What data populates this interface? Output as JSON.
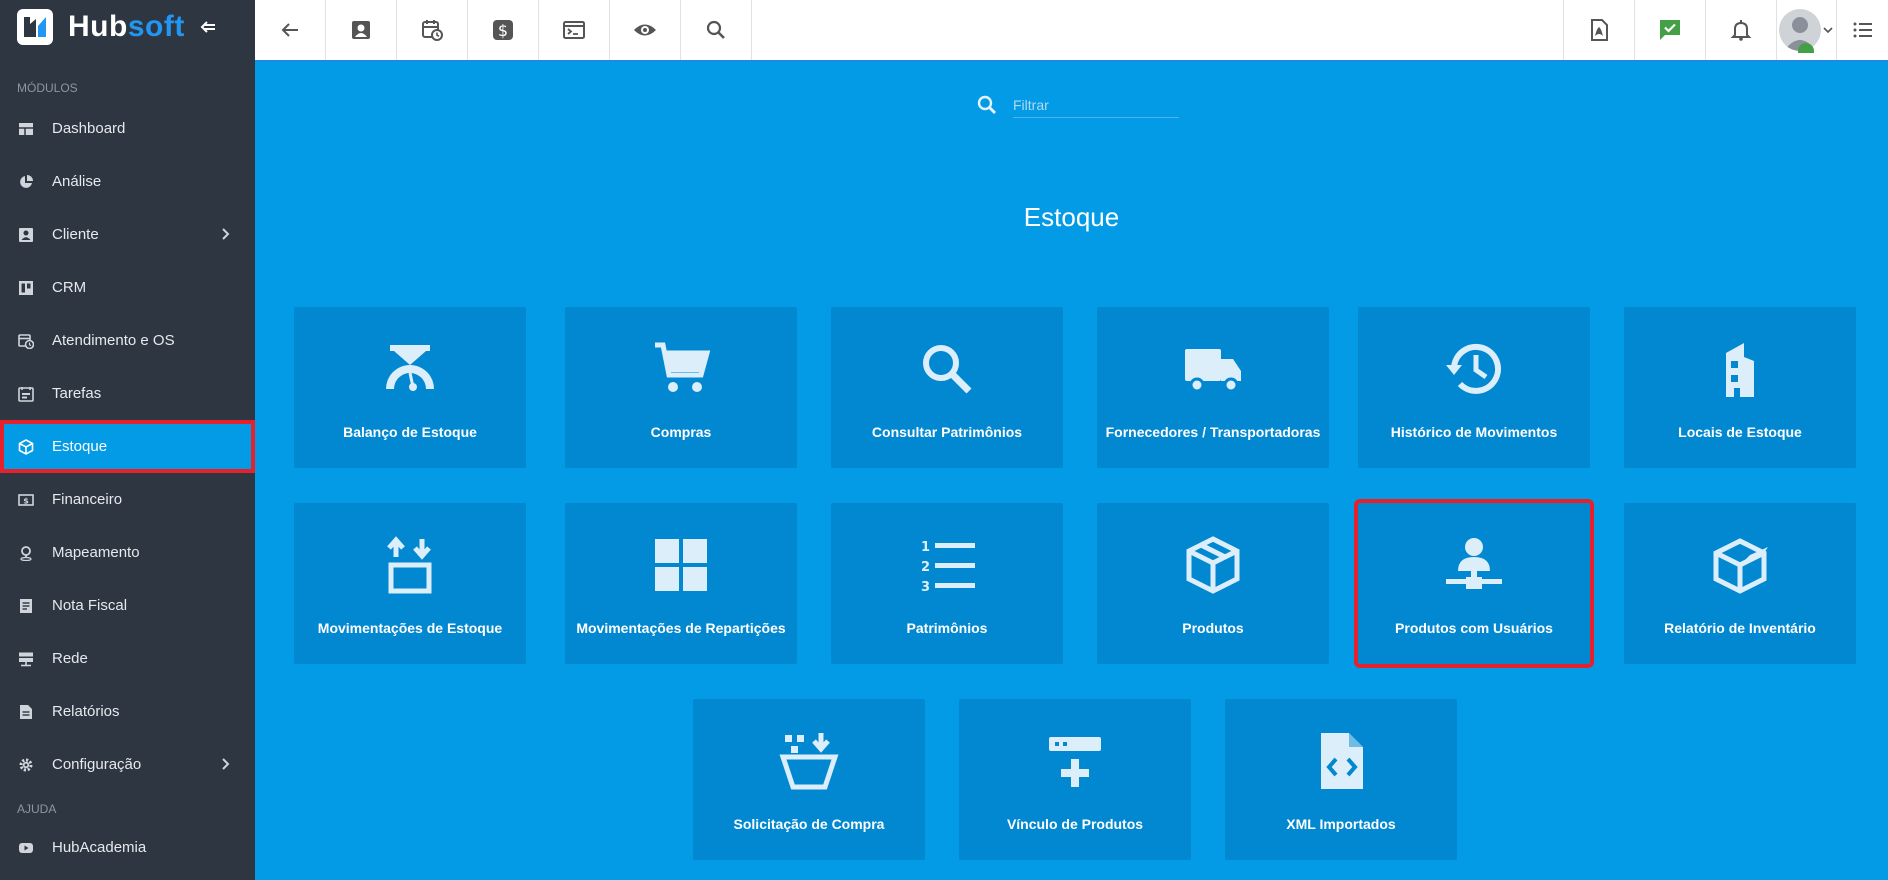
{
  "brand": {
    "hub": "Hub",
    "soft": "soft"
  },
  "sidebar": {
    "section_modulos": "MÓDULOS",
    "section_ajuda": "AJUDA",
    "items": [
      {
        "label": "Dashboard",
        "icon": "dashboard-icon"
      },
      {
        "label": "Análise",
        "icon": "pie-chart-icon"
      },
      {
        "label": "Cliente",
        "icon": "contact-card-icon",
        "has_submenu": true
      },
      {
        "label": "CRM",
        "icon": "kanban-icon"
      },
      {
        "label": "Atendimento e OS",
        "icon": "calendar-clock-icon"
      },
      {
        "label": "Tarefas",
        "icon": "tasks-icon"
      },
      {
        "label": "Estoque",
        "icon": "cube-icon",
        "active": true
      },
      {
        "label": "Financeiro",
        "icon": "money-icon"
      },
      {
        "label": "Mapeamento",
        "icon": "map-pin-icon"
      },
      {
        "label": "Nota Fiscal",
        "icon": "document-icon"
      },
      {
        "label": "Rede",
        "icon": "server-icon"
      },
      {
        "label": "Relatórios",
        "icon": "report-icon"
      },
      {
        "label": "Configuração",
        "icon": "gear-icon",
        "has_submenu": true
      }
    ],
    "help_items": [
      {
        "label": "HubAcademia",
        "icon": "youtube-icon"
      }
    ]
  },
  "topbar": {
    "left_icons": [
      "back-arrow-icon",
      "contact-card-icon",
      "calendar-clock-icon",
      "dollar-icon",
      "terminal-icon",
      "eye-icon",
      "search-icon"
    ],
    "right_icons": [
      "pdf-icon",
      "chat-check-icon",
      "bell-icon"
    ]
  },
  "search": {
    "placeholder": "Filtrar"
  },
  "page": {
    "title": "Estoque"
  },
  "tiles": [
    {
      "label": "Balanço de Estoque",
      "icon": "scale-icon"
    },
    {
      "label": "Compras",
      "icon": "shopping-cart-icon"
    },
    {
      "label": "Consultar Patrimônios",
      "icon": "magnifier-icon"
    },
    {
      "label": "Fornecedores / Transportadoras",
      "icon": "truck-icon"
    },
    {
      "label": "Histórico de Movimentos",
      "icon": "history-icon"
    },
    {
      "label": "Locais de Estoque",
      "icon": "building-icon"
    },
    {
      "label": "Movimentações de Estoque",
      "icon": "arrows-box-icon"
    },
    {
      "label": "Movimentações de Repartições",
      "icon": "grid-icon"
    },
    {
      "label": "Patrimônios",
      "icon": "numbered-list-icon"
    },
    {
      "label": "Produtos",
      "icon": "package-icon"
    },
    {
      "label": "Produtos com Usuários",
      "icon": "user-network-icon",
      "highlighted": true
    },
    {
      "label": "Relatório de Inventário",
      "icon": "open-box-icon"
    },
    {
      "label": "Solicitação de Compra",
      "icon": "basket-download-icon"
    },
    {
      "label": "Vínculo de Produtos",
      "icon": "link-add-icon"
    },
    {
      "label": "XML Importados",
      "icon": "code-file-icon"
    }
  ],
  "colors": {
    "sidebar_bg": "#2d3641",
    "main_bg": "#039be5",
    "tile_bg": "#0288d1",
    "highlight": "#e5222b",
    "accent": "#2196f3"
  }
}
